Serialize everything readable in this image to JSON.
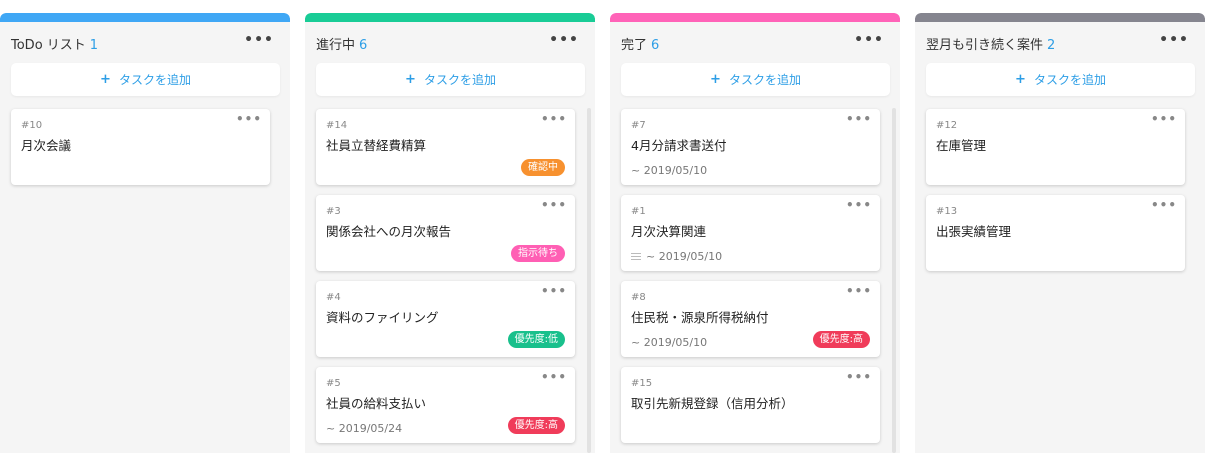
{
  "add_task_label": "タスクを追加",
  "plus_glyph": "+",
  "menu_glyph": "•••",
  "columns": [
    {
      "title": "ToDo リスト",
      "count": "1",
      "bar_color": "#3fa7f5",
      "cards": [
        {
          "num": "#10",
          "title": "月次会議",
          "date": "",
          "badge": "",
          "badge_color": ""
        }
      ]
    },
    {
      "title": "進行中",
      "count": "6",
      "bar_color": "#19cc96",
      "cards": [
        {
          "num": "#14",
          "title": "社員立替経費精算",
          "date": "",
          "badge": "確認中",
          "badge_color": "#f7912f"
        },
        {
          "num": "#3",
          "title": "関係会社への月次報告",
          "date": "",
          "badge": "指示待ち",
          "badge_color": "#ff5fb4"
        },
        {
          "num": "#4",
          "title": "資料のファイリング",
          "date": "",
          "badge": "優先度:低",
          "badge_color": "#19c08c"
        },
        {
          "num": "#5",
          "title": "社員の給料支払い",
          "date": "~ 2019/05/24",
          "badge": "優先度:高",
          "badge_color": "#f03c5a"
        }
      ]
    },
    {
      "title": "完了",
      "count": "6",
      "bar_color": "#ff63b8",
      "cards": [
        {
          "num": "#7",
          "title": "4月分請求書送付",
          "date": "~ 2019/05/10",
          "badge": "",
          "badge_color": ""
        },
        {
          "num": "#1",
          "title": "月次決算関連",
          "date": "~ 2019/05/10",
          "has_list_icon": true,
          "badge": "",
          "badge_color": ""
        },
        {
          "num": "#8",
          "title": "住民税・源泉所得税納付",
          "date": "~ 2019/05/10",
          "badge": "優先度:高",
          "badge_color": "#f03c5a"
        },
        {
          "num": "#15",
          "title": "取引先新規登録（信用分析）",
          "date": "",
          "badge": "",
          "badge_color": ""
        }
      ]
    },
    {
      "title": "翌月も引き続く案件",
      "count": "2",
      "bar_color": "#85858f",
      "cards": [
        {
          "num": "#12",
          "title": "在庫管理",
          "date": "",
          "badge": "",
          "badge_color": ""
        },
        {
          "num": "#13",
          "title": "出張実績管理",
          "date": "",
          "badge": "",
          "badge_color": ""
        }
      ]
    }
  ]
}
